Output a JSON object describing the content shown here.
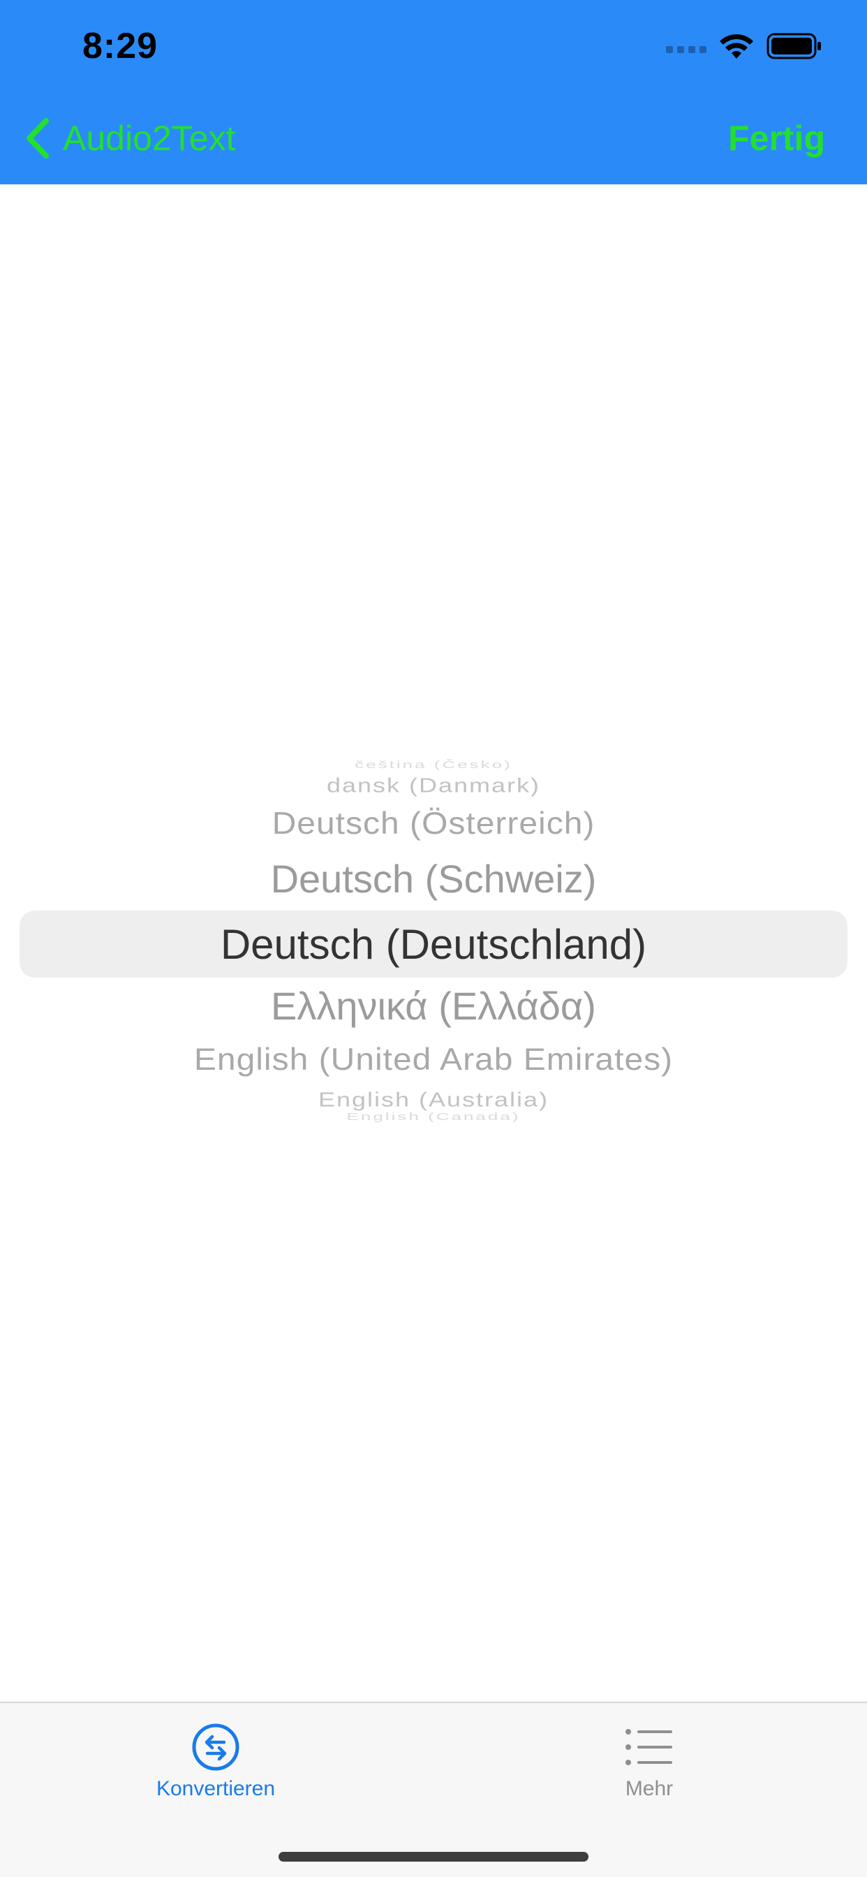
{
  "status_bar": {
    "time": "8:29"
  },
  "nav": {
    "back_label": "Audio2Text",
    "done_label": "Fertig",
    "accent_color": "#22E02C",
    "background_color": "#2A8BF8"
  },
  "picker": {
    "selected": "Deutsch (Deutschland)",
    "items_above": [
      "čeština (Česko)",
      "dansk (Danmark)",
      "Deutsch (Österreich)",
      "Deutsch (Schweiz)"
    ],
    "items_below": [
      "Ελληνικά (Ελλάδα)",
      "English (United Arab Emirates)",
      "English (Australia)",
      "English (Canada)"
    ]
  },
  "tabbar": {
    "convert_label": "Konvertieren",
    "more_label": "Mehr",
    "active_color": "#1A7BE8",
    "inactive_color": "#8E8E93",
    "convert_icon": "arrows-exchange-icon",
    "more_icon": "list-icon"
  }
}
